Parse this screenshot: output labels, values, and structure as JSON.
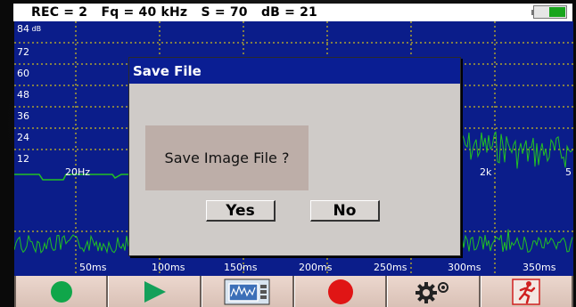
{
  "status_bar": {
    "text": "REC = 2   Fq = 40 kHz   S = 70   dB = 21",
    "battery_icon": "battery-icon",
    "battery_color": "#19a51d"
  },
  "spectrum": {
    "y_labels": [
      "84",
      "72",
      "60",
      "48",
      "36",
      "24",
      "12"
    ],
    "y_unit": "dB",
    "x_labels": [
      "20Hz",
      "2k",
      "5"
    ],
    "background_color": "#0b1d8a",
    "trace_color": "#22c222"
  },
  "waveform": {
    "time_labels": [
      "50ms",
      "100ms",
      "150ms",
      "200ms",
      "250ms",
      "300ms",
      "350ms"
    ]
  },
  "dialog": {
    "title": "Save File",
    "message": "Save Image File ?",
    "yes_label": "Yes",
    "no_label": "No"
  },
  "toolbar": {
    "buttons": [
      {
        "icon": "green-circle-icon"
      },
      {
        "icon": "play-icon"
      },
      {
        "icon": "spectrum-image-icon"
      },
      {
        "icon": "record-icon"
      },
      {
        "icon": "settings-gears-icon"
      },
      {
        "icon": "exit-running-man-icon"
      }
    ],
    "colors": {
      "green": "#10a64a",
      "play": "#14a05a",
      "record": "#e01515"
    }
  }
}
